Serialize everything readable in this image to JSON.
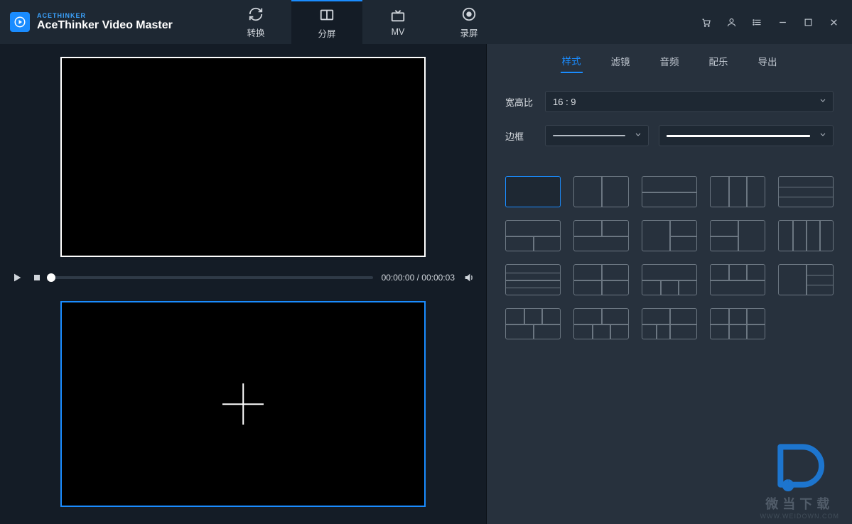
{
  "brand": {
    "small": "ACETHINKER",
    "title": "AceThinker Video Master"
  },
  "mainTabs": {
    "t0": "转换",
    "t1": "分屏",
    "t2": "MV",
    "t3": "录屏"
  },
  "player": {
    "time": "00:00:00 / 00:00:03"
  },
  "rightTabs": {
    "t0": "样式",
    "t1": "滤镜",
    "t2": "音频",
    "t3": "配乐",
    "t4": "导出"
  },
  "style": {
    "aspectLabel": "宽高比",
    "aspectValue": "16 : 9",
    "borderLabel": "边框"
  },
  "watermark": {
    "text1": "微当下载",
    "text2": "WWW.WEIDOWN.COM"
  }
}
